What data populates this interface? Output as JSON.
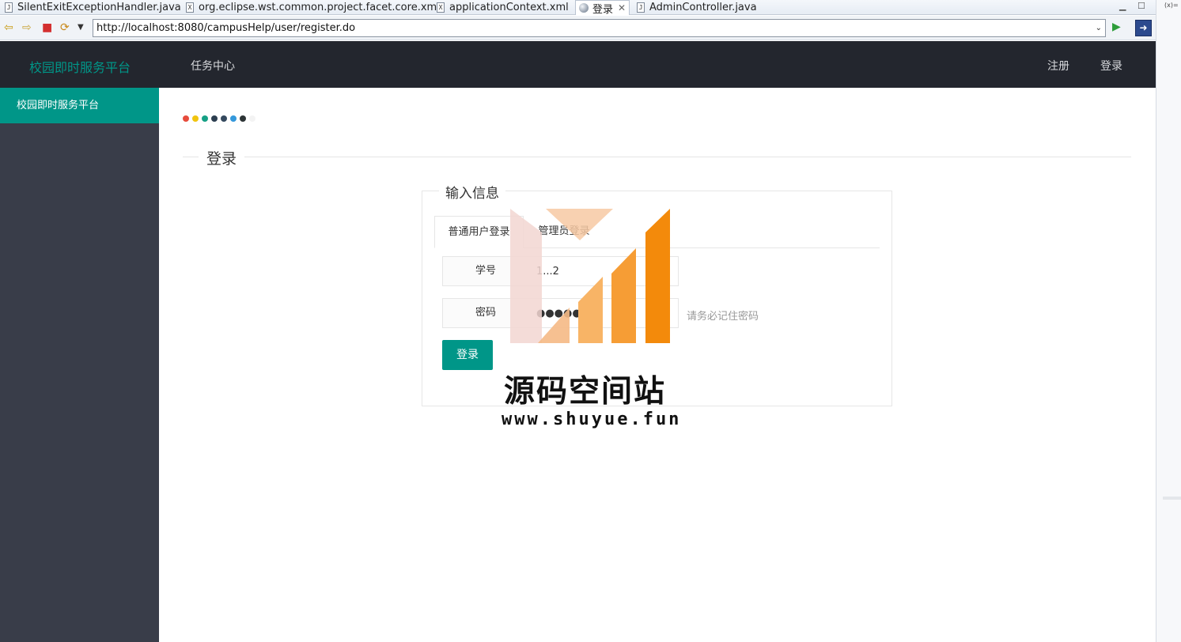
{
  "ide": {
    "tabs": [
      {
        "label": "SilentExitExceptionHandler.java",
        "icon": "java-file-icon"
      },
      {
        "label": "org.eclipse.wst.common.project.facet.core.xml",
        "icon": "xml-file-icon"
      },
      {
        "label": "applicationContext.xml",
        "icon": "xml-file-icon"
      },
      {
        "label": "登录",
        "icon": "globe-icon",
        "active": true
      },
      {
        "label": "AdminController.java",
        "icon": "java-file-icon"
      }
    ],
    "side_label": "(x)="
  },
  "browser": {
    "url": "http://localhost:8080/campusHelp/user/register.do"
  },
  "site": {
    "logo": "校园即时服务平台",
    "nav_task": "任务中心",
    "nav_register": "注册",
    "nav_login": "登录"
  },
  "sidebar": {
    "items": [
      {
        "label": "校园即时服务平台"
      }
    ]
  },
  "main": {
    "dot_colors": [
      "#e74c3c",
      "#f1c40f",
      "#16a085",
      "#2c3e50",
      "#34495e",
      "#3498db",
      "#2d3436",
      "#f3f3f3"
    ],
    "section_title": "登录",
    "fieldset_title": "输入信息",
    "tabs": [
      "普通用户登录",
      "管理员登录"
    ],
    "form": {
      "student_id_label": "学号",
      "student_id_value": "1...2",
      "password_label": "密码",
      "password_value": "●●●●●",
      "password_hint": "请务必记住密码",
      "submit_label": "登录"
    }
  },
  "watermark": {
    "title": "源码空间站",
    "url": "www.shuyue.fun"
  },
  "colors": {
    "accent": "#009688",
    "header_bg": "#23262e",
    "sidebar_bg": "#393d49"
  }
}
